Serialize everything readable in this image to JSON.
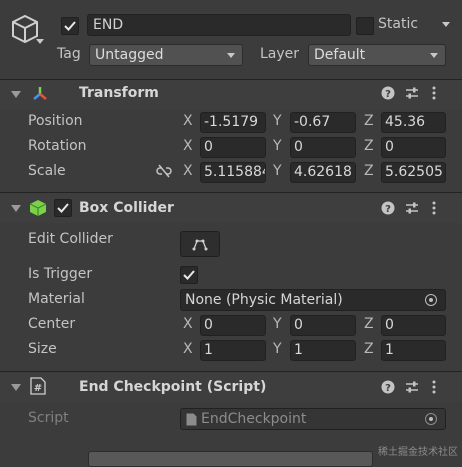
{
  "header": {
    "object_name": "END",
    "active_checked": true,
    "static_label": "Static",
    "static_checked": false,
    "tag_label": "Tag",
    "tag_value": "Untagged",
    "layer_label": "Layer",
    "layer_value": "Default"
  },
  "transform": {
    "title": "Transform",
    "rows": [
      {
        "label": "Position",
        "x": "-1.5179",
        "y": "-0.67",
        "z": "45.36"
      },
      {
        "label": "Rotation",
        "x": "0",
        "y": "0",
        "z": "0"
      },
      {
        "label": "Scale",
        "x": "5.115884",
        "y": "4.62618",
        "z": "5.62505"
      }
    ]
  },
  "box_collider": {
    "title": "Box Collider",
    "enabled": true,
    "edit_collider_label": "Edit Collider",
    "is_trigger_label": "Is Trigger",
    "is_trigger_checked": true,
    "material_label": "Material",
    "material_value": "None (Physic Material)",
    "center_label": "Center",
    "center": {
      "x": "0",
      "y": "0",
      "z": "0"
    },
    "size_label": "Size",
    "size": {
      "x": "1",
      "y": "1",
      "z": "1"
    }
  },
  "script_component": {
    "title": "End Checkpoint (Script)",
    "script_label": "Script",
    "script_value": "EndCheckpoint"
  },
  "axis_labels": {
    "x": "X",
    "y": "Y",
    "z": "Z"
  },
  "watermark": "稀土掘金技术社区"
}
